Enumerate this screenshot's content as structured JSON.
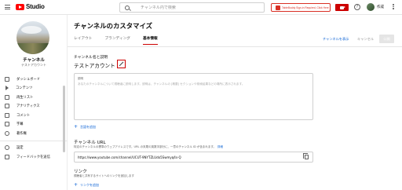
{
  "topbar": {
    "logo_text": "Studio",
    "search_placeholder": "チャンネル内で検索",
    "extension_banner": "TableBuddy Sign-in Required, Click Here",
    "help_glyph": "?",
    "user_name": "作成",
    "icons": [
      "menu-icon",
      "youtube-logo-icon",
      "search-icon",
      "create-video-icon",
      "help-icon",
      "more-icon"
    ]
  },
  "sidebar": {
    "channel_title": "チャンネル",
    "channel_subtitle": "テストアカウント",
    "items": [
      {
        "label": "ダッシュボード",
        "icon": "dashboard-icon"
      },
      {
        "label": "コンテンツ",
        "icon": "content-icon"
      },
      {
        "label": "再生リスト",
        "icon": "playlist-icon"
      },
      {
        "label": "アナリティクス",
        "icon": "analytics-icon"
      },
      {
        "label": "コメント",
        "icon": "comment-icon"
      },
      {
        "label": "字幕",
        "icon": "subtitles-icon"
      },
      {
        "label": "著作権",
        "icon": "copyright-icon"
      }
    ],
    "footer_items": [
      {
        "label": "設定",
        "icon": "gear-icon"
      },
      {
        "label": "フィードバックを送信",
        "icon": "feedback-icon"
      }
    ]
  },
  "main": {
    "page_title": "チャンネルのカスタマイズ",
    "tabs": [
      {
        "label": "レイアウト",
        "active": false
      },
      {
        "label": "ブランディング",
        "active": false
      },
      {
        "label": "基本情報",
        "active": true
      }
    ],
    "view_channel_link": "チャンネルを表示",
    "cancel_label": "キャンセル",
    "publish_label": "公開",
    "name_section_label": "チャンネル名と説明",
    "channel_name": "テストアカウント",
    "description_label": "説明",
    "description_placeholder": "あなたのチャンネルについて視聴者に説明します。説明は、チャンネルの [概要] セクションや検索結果などの場所に表示されます。",
    "add_language_label": "言語を追加",
    "url_title": "チャンネル URL",
    "url_desc": "特定のチャンネルの標準のウェブアドレスです。URL の末尾の英数字部分に、一意のチャンネル ID が含まれます。",
    "url_more_link": "詳細",
    "channel_url": "https://www.youtube.com/channel/UCUT-9NYTZLUdo5Swmyq4s-Q",
    "links_title": "リンク",
    "links_desc": "視聴者と共有するサイトへのリンクを追加します",
    "add_link_label": "リンクを追加"
  },
  "colors": {
    "accent_red": "#cc0000",
    "link_blue": "#065fd4",
    "banner_red": "#d93025"
  }
}
